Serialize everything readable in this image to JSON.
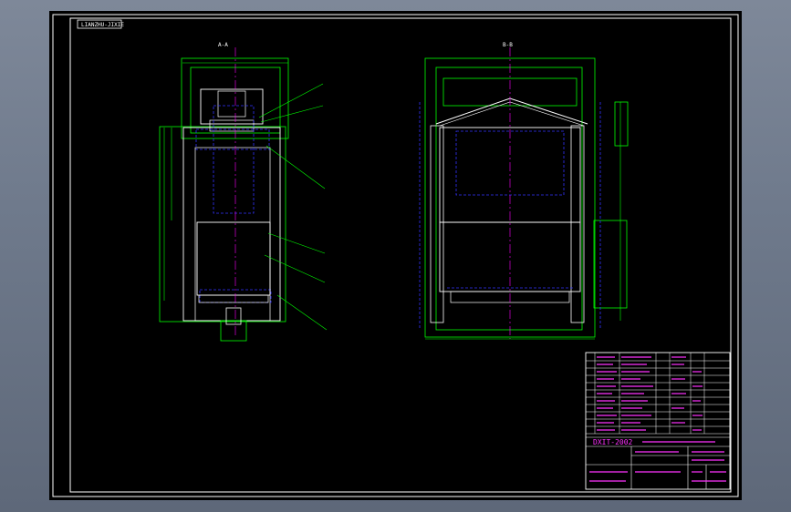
{
  "drawing": {
    "view_label_left": "A-A",
    "view_label_right": "B-B",
    "tag_text": "LIANZHU-JIXIE",
    "title_block": {
      "year_text": "DXIT-2002"
    }
  },
  "colors": {
    "background": "#000000",
    "frame": "#ffffff",
    "outline_green": "#00ff00",
    "hidden_blue": "#3333ff",
    "center_magenta": "#ff00ff",
    "part_white": "#ffffff"
  }
}
